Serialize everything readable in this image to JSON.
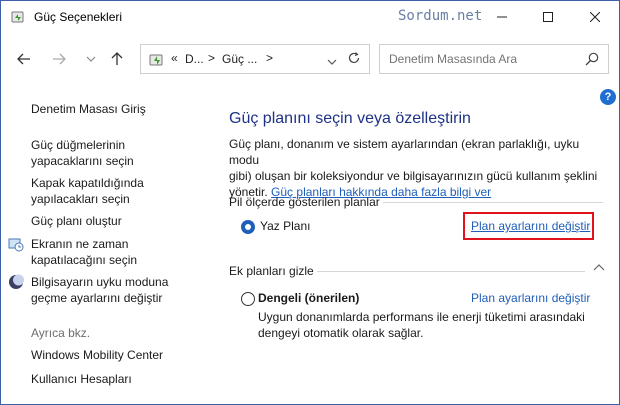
{
  "window": {
    "title": "Güç Seçenekleri",
    "watermark": "Sordum.net"
  },
  "address": {
    "sep1": "«",
    "part1": "D...",
    "sep2": ">",
    "part2": "Güç ...",
    "sep3": ">"
  },
  "search": {
    "placeholder": "Denetim Masasında Ara"
  },
  "help_label": "?",
  "sidebar": {
    "home": "Denetim Masası Giriş",
    "items": [
      {
        "label1": "Güç düğmelerinin",
        "label2": "yapacaklarını seçin"
      },
      {
        "label1": "Kapak kapatıldığında",
        "label2": "yapılacakları seçin"
      },
      {
        "label1": "Güç planı oluştur"
      },
      {
        "label1": "Ekranın ne zaman",
        "label2": "kapatılacağını seçin"
      },
      {
        "label1": "Bilgisayarın uyku moduna",
        "label2": "geçme ayarlarını değiştir"
      }
    ],
    "see_also": "Ayrıca bkz.",
    "see_also_items": [
      "Windows Mobility Center",
      "Kullanıcı Hesapları"
    ]
  },
  "main": {
    "heading": "Güç planını seçin veya özelleştirin",
    "desc_line1": "Güç planı, donanım ve sistem ayarlarından (ekran parlaklığı, uyku modu",
    "desc_line2": "gibi) oluşan bir koleksiyondur ve bilgisayarınızın gücü kullanım şeklini",
    "desc_line3": "yönetir.",
    "desc_link": "Güç planları hakkında daha fazla bilgi ver",
    "battery_section": "Pil ölçerde gösterilen planlar",
    "plan1_name": "Yaz Planı",
    "plan1_link": "Plan ayarlarını değiştir",
    "extra_section": "Ek planları gizle",
    "plan2_name": "Dengeli (önerilen)",
    "plan2_link": "Plan ayarlarını değiştir",
    "plan2_desc_line1": "Uygun donanımlarda performans ile enerji tüketimi arasındaki",
    "plan2_desc_line2": "dengeyi otomatik olarak sağlar."
  },
  "colors": {
    "heading": "#1e3287",
    "link": "#1e5fba",
    "highlight": "#e0121b"
  }
}
